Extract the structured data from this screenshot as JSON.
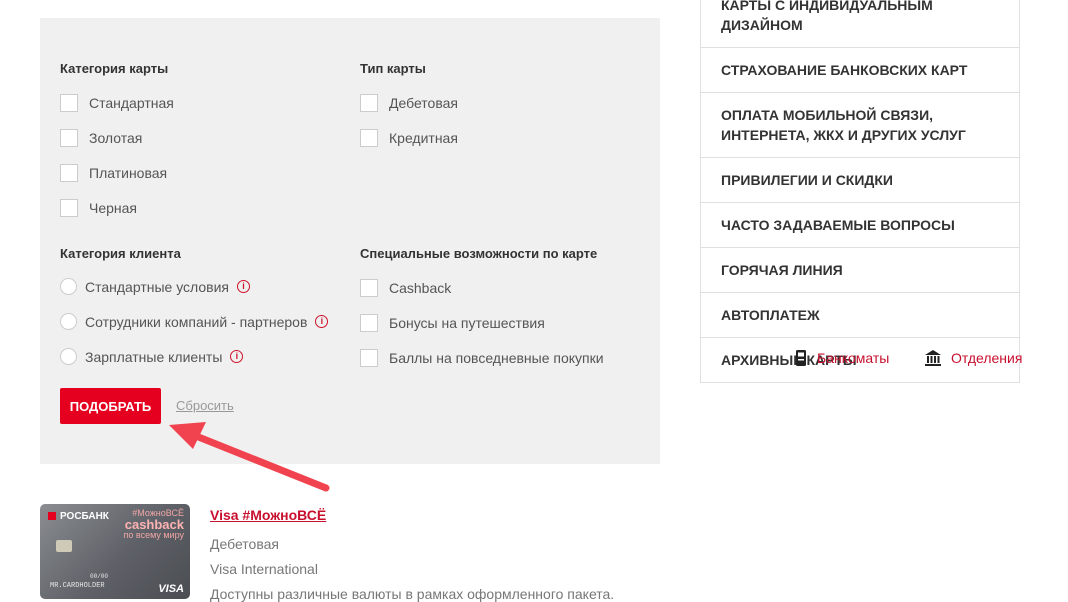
{
  "filters": {
    "card_category": {
      "title": "Категория карты",
      "options": [
        "Стандартная",
        "Золотая",
        "Платиновая",
        "Черная"
      ]
    },
    "card_type": {
      "title": "Тип карты",
      "options": [
        "Дебетовая",
        "Кредитная"
      ]
    },
    "client_category": {
      "title": "Категория клиента",
      "options": [
        "Стандартные условия",
        "Сотрудники компаний - партнеров",
        "Зарплатные клиенты"
      ]
    },
    "special": {
      "title": "Специальные возможности по карте",
      "options": [
        "Cashback",
        "Бонусы на путешествия",
        "Баллы на повседневные покупки"
      ]
    },
    "submit_label": "ПОДОБРАТЬ",
    "reset_label": "Сбросить",
    "info_glyph": "i"
  },
  "card": {
    "title": "Visa #МожноВСЁ",
    "type": "Дебетовая",
    "network": "Visa International",
    "description": "Доступны различные валюты в рамках оформленного пакета.",
    "image": {
      "bank_logo": "РОСБАНК",
      "promo_hashtag": "#МожноВСЁ",
      "promo_big": "cashback",
      "promo_small": "по всему миру",
      "expiry": "00/00",
      "holder": "MR.CARDHOLDER",
      "brand": "VISA"
    }
  },
  "side_menu": {
    "items": [
      "КАРТЫ С ИНДИВИДУАЛЬНЫМ ДИЗАЙНОМ",
      "СТРАХОВАНИЕ БАНКОВСКИХ КАРТ",
      "ОПЛАТА МОБИЛЬНОЙ СВЯЗИ, ИНТЕРНЕТА, ЖКХ И ДРУГИХ УСЛУГ",
      "ПРИВИЛЕГИИ И СКИДКИ",
      "ЧАСТО ЗАДАВАЕМЫЕ ВОПРОСЫ",
      "ГОРЯЧАЯ ЛИНИЯ",
      "АВТОПЛАТЕЖ",
      "АРХИВНЫЕ КАРТЫ"
    ],
    "atm_label": "Банкоматы",
    "branches_label": "Отделения"
  },
  "colors": {
    "accent": "#e5001f",
    "link": "#c8102e",
    "panel_bg": "#f0f0f0",
    "arrow": "#f0434f"
  },
  "icons": [
    "info-icon",
    "atm-icon",
    "bank-building-icon"
  ]
}
